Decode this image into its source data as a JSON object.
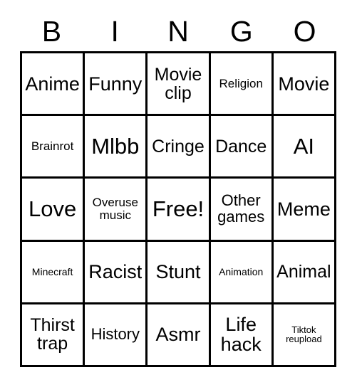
{
  "card": {
    "title": "BINGO",
    "header_letters": [
      "B",
      "I",
      "N",
      "G",
      "O"
    ],
    "grid_size": "5x5",
    "colors": {
      "background": "#ffffff",
      "border": "#000000",
      "text": "#000000"
    },
    "rows": [
      [
        {
          "label": "Anime",
          "size": "xl",
          "marked": false
        },
        {
          "label": "Funny",
          "size": "xl",
          "marked": false
        },
        {
          "label": "Movie\nclip",
          "size": "lg",
          "marked": false
        },
        {
          "label": "Religion",
          "size": "sm",
          "marked": false
        },
        {
          "label": "Movie",
          "size": "xl",
          "marked": false
        }
      ],
      [
        {
          "label": "Brainrot",
          "size": "sm",
          "marked": false
        },
        {
          "label": "Mlbb",
          "size": "xxl",
          "marked": false
        },
        {
          "label": "Cringe",
          "size": "lg",
          "marked": false
        },
        {
          "label": "Dance",
          "size": "lg",
          "marked": false
        },
        {
          "label": "AI",
          "size": "xxl",
          "marked": false
        }
      ],
      [
        {
          "label": "Love",
          "size": "xxl",
          "marked": false
        },
        {
          "label": "Overuse\nmusic",
          "size": "sm",
          "marked": false
        },
        {
          "label": "Free!",
          "size": "xxl",
          "marked": false
        },
        {
          "label": "Other\ngames",
          "size": "md",
          "marked": false
        },
        {
          "label": "Meme",
          "size": "xl",
          "marked": false
        }
      ],
      [
        {
          "label": "Minecraft",
          "size": "xs",
          "marked": false
        },
        {
          "label": "Racist",
          "size": "xl",
          "marked": false
        },
        {
          "label": "Stunt",
          "size": "xl",
          "marked": false
        },
        {
          "label": "Animation",
          "size": "xs",
          "marked": false
        },
        {
          "label": "Animal",
          "size": "lg",
          "marked": false
        }
      ],
      [
        {
          "label": "Thirst\ntrap",
          "size": "lg",
          "marked": false
        },
        {
          "label": "History",
          "size": "md",
          "marked": false
        },
        {
          "label": "Asmr",
          "size": "xl",
          "marked": false
        },
        {
          "label": "Life\nhack",
          "size": "xl",
          "marked": false
        },
        {
          "label": "Tiktok\nreupload",
          "size": "xxs",
          "marked": false
        }
      ]
    ]
  }
}
